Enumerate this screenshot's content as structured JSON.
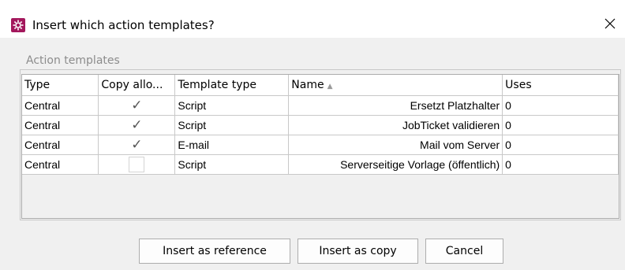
{
  "window": {
    "title": "Insert which action templates?",
    "app_icon": "gear-icon",
    "close_icon": "close-icon"
  },
  "group": {
    "label": "Action templates"
  },
  "table": {
    "columns": [
      "Type",
      "Copy allo...",
      "Template type",
      "Name",
      "Uses"
    ],
    "sort_column": "Name",
    "rows": [
      {
        "type": "Central",
        "copy_allowed": true,
        "template_type": "Script",
        "name": "Ersetzt Platzhalter",
        "uses": "0"
      },
      {
        "type": "Central",
        "copy_allowed": true,
        "template_type": "Script",
        "name": "JobTicket validieren",
        "uses": "0"
      },
      {
        "type": "Central",
        "copy_allowed": true,
        "template_type": "E-mail",
        "name": "Mail vom Server",
        "uses": "0"
      },
      {
        "type": "Central",
        "copy_allowed": false,
        "template_type": "Script",
        "name": "Serverseitige Vorlage (öffentlich)",
        "uses": "0"
      }
    ]
  },
  "buttons": {
    "insert_reference": "Insert as reference",
    "insert_copy": "Insert as copy",
    "cancel": "Cancel"
  },
  "colors": {
    "app_icon_bg": "#a3175c"
  }
}
